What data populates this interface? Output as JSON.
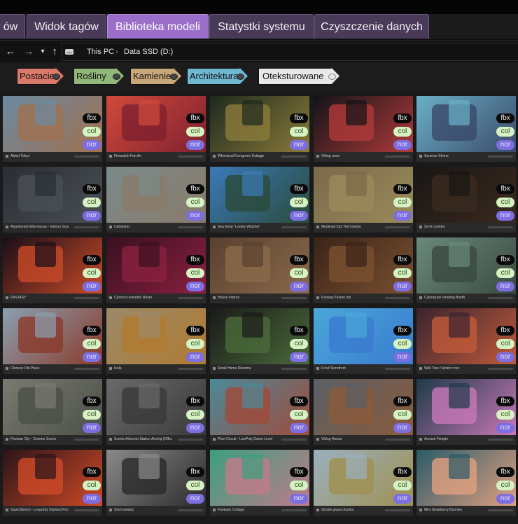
{
  "tabs": [
    {
      "label": "ów",
      "active": false
    },
    {
      "label": "Widok tagów",
      "active": false
    },
    {
      "label": "Biblioteka modeli",
      "active": true
    },
    {
      "label": "Statystki systemu",
      "active": false
    },
    {
      "label": "Czyszczenie danych",
      "active": false
    }
  ],
  "nav": {
    "back_icon": "arrow-left-icon",
    "forward_icon": "arrow-right-icon",
    "dropdown_icon": "chevron-down-icon",
    "up_icon": "arrow-up-icon",
    "drive_icon": "drive-icon",
    "breadcrumb": [
      "This PC",
      "Data SSD (D:)"
    ]
  },
  "tags": [
    {
      "label": "Postacie",
      "color": "#d97a6a"
    },
    {
      "label": "Rośliny",
      "color": "#8fb87a"
    },
    {
      "label": "Kamienie",
      "color": "#c8a878"
    },
    {
      "label": "Architektura",
      "color": "#6fb8d2"
    },
    {
      "label": "Oteksturowane",
      "color": "#e8e8e8"
    }
  ],
  "formats": [
    "fbx",
    "col",
    "nor"
  ],
  "cards": [
    {
      "title": "Abbot Tokyo",
      "c1": "#6a8aa0",
      "c2": "#a07050"
    },
    {
      "title": "Firewatch Fan Art",
      "c1": "#d04a3a",
      "c2": "#802030"
    },
    {
      "title": "Whimsical Evergreen Cottage",
      "c1": "#1e2a1e",
      "c2": "#8a7a3a"
    },
    {
      "title": "Viking room",
      "c1": "#121418",
      "c2": "#b03a3a"
    },
    {
      "title": "Summer Shrine",
      "c1": "#6ab0c8",
      "c2": "#3a4a6a"
    },
    {
      "title": "Abandoned Warehouse - Interior Scene",
      "c1": "#2a2e34",
      "c2": "#4a4f56"
    },
    {
      "title": "Cathedral",
      "c1": "#7a8a8a",
      "c2": "#8a7a6a"
    },
    {
      "title": "Sea Keep \"Lonely Watcher\"",
      "c1": "#3a7ab8",
      "c2": "#2a4a3a"
    },
    {
      "title": "Medieval City Tech Demo",
      "c1": "#7a6a4a",
      "c2": "#9a8a5a"
    },
    {
      "title": "Sci-fi corridor",
      "c1": "#1a1614",
      "c2": "#3a2a20"
    },
    {
      "title": "FANTASY",
      "c1": "#1a0e18",
      "c2": "#c84a28"
    },
    {
      "title": "Cartoon Isometric Room",
      "c1": "#3a1020",
      "c2": "#8a2040"
    },
    {
      "title": "House Interior",
      "c1": "#5a4030",
      "c2": "#8a6a4a"
    },
    {
      "title": "Fantasy Tavern Inn",
      "c1": "#3a2418",
      "c2": "#7a5030"
    },
    {
      "title": "Cyberpunk Vending Booth",
      "c1": "#6a8a7a",
      "c2": "#3a4a40"
    },
    {
      "title": "Chinese Old Place",
      "c1": "#8aa0b0",
      "c2": "#8a3a2a"
    },
    {
      "title": "Isola",
      "c1": "#9a8a6a",
      "c2": "#b07a30"
    },
    {
      "title": "Small Home Diorama",
      "c1": "#1a1a1a",
      "c2": "#4a6a3a"
    },
    {
      "title": "Food Storefront",
      "c1": "#4aa8d8",
      "c2": "#3a7ad0"
    },
    {
      "title": "Wall Tree / lantern tree",
      "c1": "#3a2430",
      "c2": "#c05a3a"
    },
    {
      "title": "Postwar City - Exterior Scene",
      "c1": "#7a7a70",
      "c2": "#4a5048"
    },
    {
      "title": "Scenic Airborne Station Airship (Official)",
      "c1": "#6a6a6a",
      "c2": "#3a3a3a"
    },
    {
      "title": "Pixel Circuit - LowPoly Game Level",
      "c1": "#4a8a9a",
      "c2": "#a04a3a"
    },
    {
      "title": "Viking House",
      "c1": "#5a6066",
      "c2": "#8a5a3a"
    },
    {
      "title": "Ancient Temple",
      "c1": "#1e3a48",
      "c2": "#c878b8"
    },
    {
      "title": "SuperSketch - Leopardy Stylized Food Cart",
      "c1": "#2a1418",
      "c2": "#d04a28"
    },
    {
      "title": "Stormsweep",
      "c1": "#8a8a8a",
      "c2": "#2a2a2a"
    },
    {
      "title": "Fantasty Cottage",
      "c1": "#3aa080",
      "c2": "#c07a8a"
    },
    {
      "title": "Simple grass chunks",
      "c1": "#9ab0c0",
      "c2": "#a09050"
    },
    {
      "title": "Mini Strawberry Bunnies",
      "c1": "#2a5a68",
      "c2": "#e0a080"
    }
  ]
}
